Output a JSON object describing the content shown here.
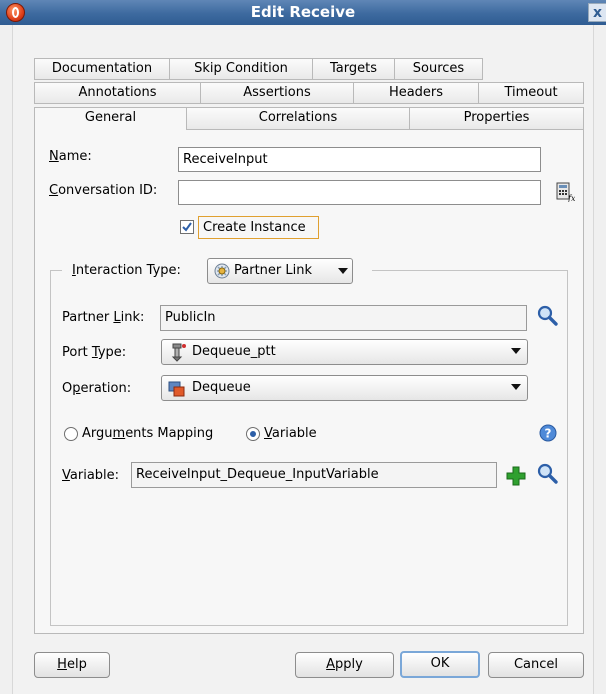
{
  "window": {
    "title": "Edit Receive",
    "close_glyph": "x"
  },
  "tabs": {
    "row1": [
      "Documentation",
      "Skip Condition",
      "Targets",
      "Sources"
    ],
    "row2": [
      "Annotations",
      "Assertions",
      "Headers",
      "Timeout"
    ],
    "row3": [
      "General",
      "Correlations",
      "Properties"
    ],
    "active": "General"
  },
  "general": {
    "name_label": "Name:",
    "name_value": "ReceiveInput",
    "conversation_label": "Conversation ID:",
    "conversation_value": "",
    "create_instance_label": "Create Instance",
    "create_instance_checked": true,
    "interaction_label": "Interaction Type:",
    "interaction_value": "Partner Link",
    "partner_link_label": "Partner Link:",
    "partner_link_value": "PublicIn",
    "port_type_label": "Port Type:",
    "port_type_value": "Dequeue_ptt",
    "operation_label": "Operation:",
    "operation_value": "Dequeue",
    "arguments_mapping_label": "Arguments Mapping",
    "variable_radio_label": "Variable",
    "selected_mode": "Variable",
    "variable_label": "Variable:",
    "variable_value": "ReceiveInput_Dequeue_InputVariable"
  },
  "footer": {
    "help": "Help",
    "apply": "Apply",
    "ok": "OK",
    "cancel": "Cancel"
  },
  "colors": {
    "title_bar": "#3d6a9f",
    "accent": "#7aa7d8",
    "highlight_border": "#e0a030",
    "add_green": "#2fa02f"
  },
  "icons": [
    "oracle-app-icon",
    "close-icon",
    "expression-builder-icon",
    "partner-link-icon",
    "search-icon",
    "port-type-icon",
    "operation-icon",
    "help-icon",
    "add-icon",
    "dropdown-arrow-icon",
    "checkbox-checked-icon"
  ]
}
